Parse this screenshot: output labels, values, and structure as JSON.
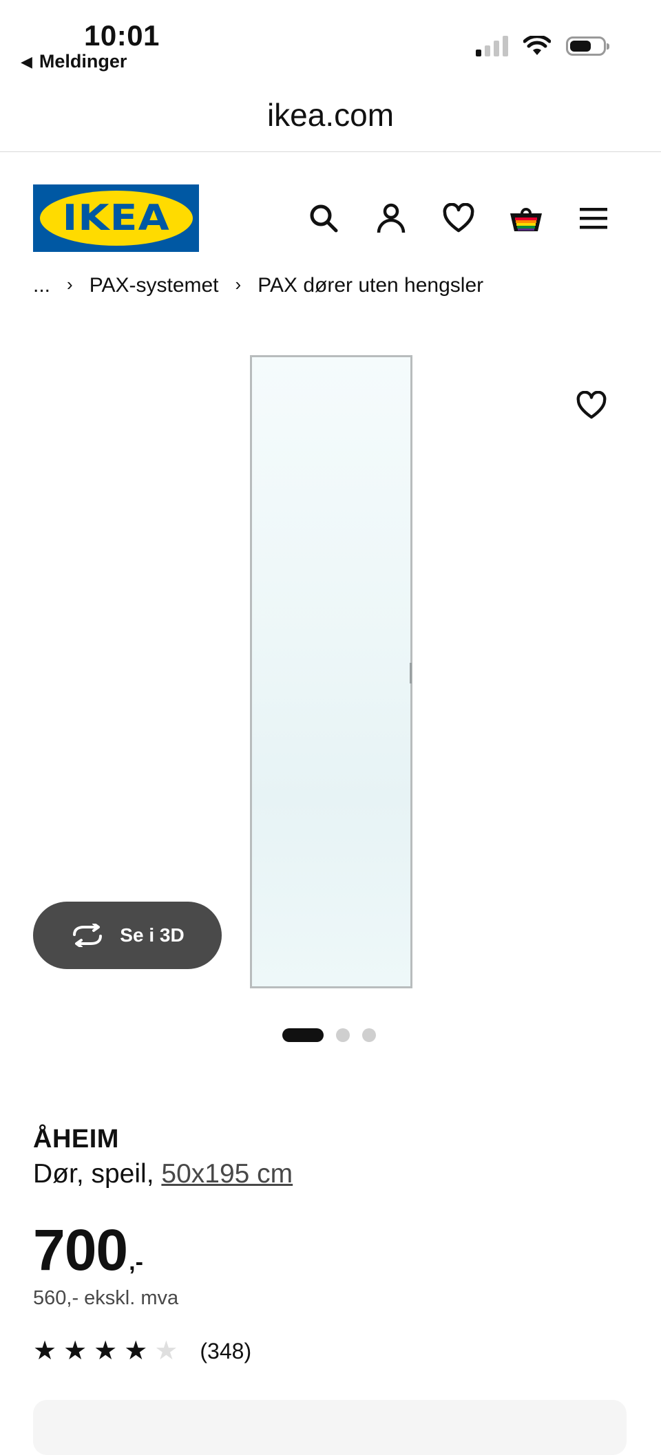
{
  "status_bar": {
    "time": "10:01",
    "back_app_label": "Meldinger",
    "icons": [
      "signal-icon",
      "wifi-icon",
      "battery-icon"
    ]
  },
  "browser": {
    "url": "ikea.com"
  },
  "header": {
    "logo_text": "IKEA",
    "icons": [
      "search-icon",
      "account-icon",
      "favorites-icon",
      "basket-icon",
      "menu-icon"
    ],
    "colors": {
      "logo_blue": "#0058a3",
      "logo_yellow": "#ffdb00"
    }
  },
  "breadcrumb": {
    "items": [
      "...",
      "PAX-systemet",
      "PAX dører uten hengsler"
    ],
    "separator": "›"
  },
  "gallery": {
    "view_3d_label": "Se i 3D",
    "slide_count": 3,
    "active_slide": 1
  },
  "product": {
    "name": "ÅHEIM",
    "type": "Dør, speil,",
    "size": "50x195 cm",
    "price": "700",
    "price_suffix": ",-",
    "price_ex_vat": "560,- ekskl. mva",
    "rating": 4,
    "rating_max": 5,
    "review_count": "(348)"
  }
}
